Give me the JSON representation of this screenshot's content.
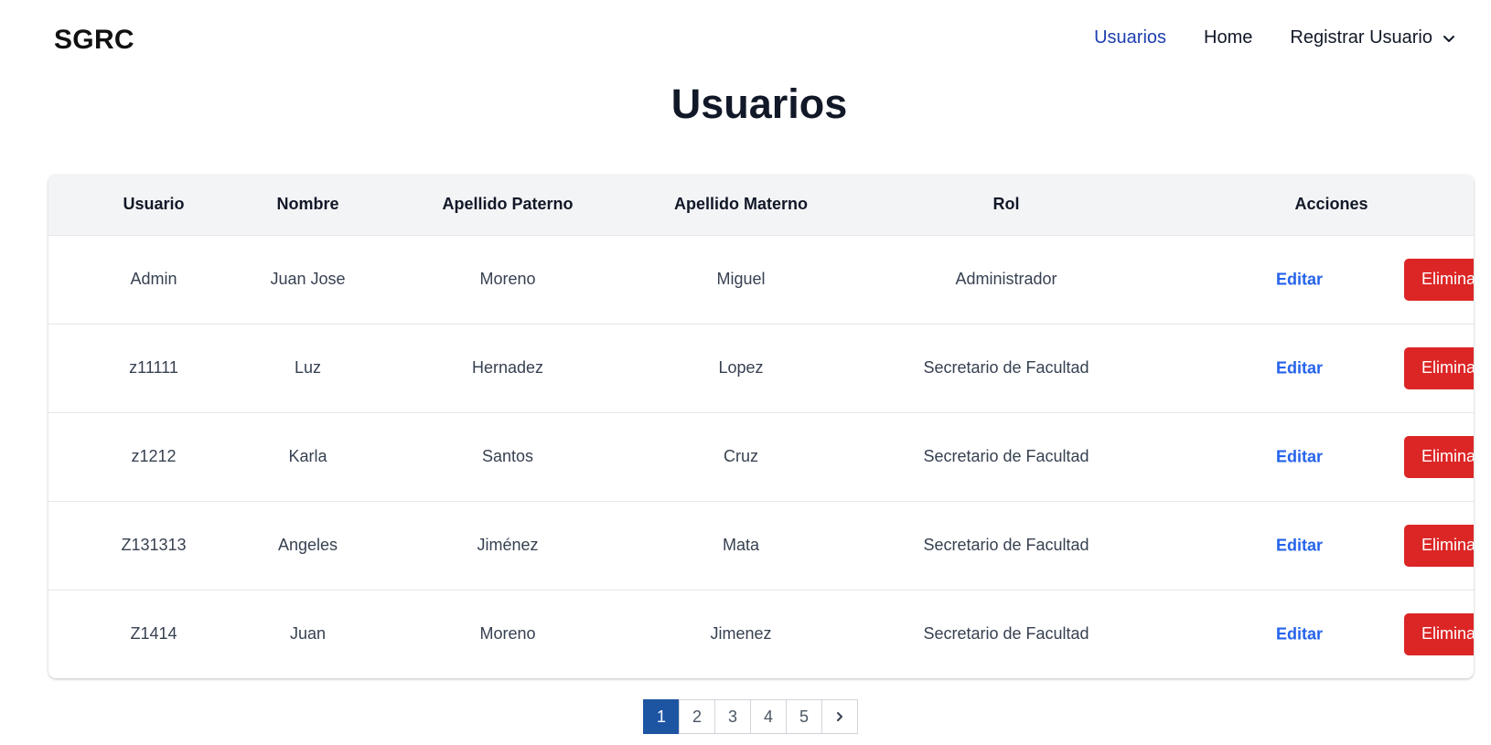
{
  "navbar": {
    "brand": "SGRC",
    "links": [
      {
        "label": "Usuarios",
        "active": true
      },
      {
        "label": "Home",
        "active": false
      }
    ],
    "dropdown": {
      "label": "Registrar Usuario",
      "icon": "chevron-down-icon"
    }
  },
  "page": {
    "title": "Usuarios"
  },
  "table": {
    "headers": [
      "Usuario",
      "Nombre",
      "Apellido Paterno",
      "Apellido Materno",
      "Rol",
      "Acciones"
    ],
    "rows": [
      {
        "usuario": "Admin",
        "nombre": "Juan Jose",
        "paterno": "Moreno",
        "materno": "Miguel",
        "rol": "Administrador"
      },
      {
        "usuario": "z11111",
        "nombre": "Luz",
        "paterno": "Hernadez",
        "materno": "Lopez",
        "rol": "Secretario de Facultad"
      },
      {
        "usuario": "z1212",
        "nombre": "Karla",
        "paterno": "Santos",
        "materno": "Cruz",
        "rol": "Secretario de Facultad"
      },
      {
        "usuario": "Z131313",
        "nombre": "Angeles",
        "paterno": "Jiménez",
        "materno": "Mata",
        "rol": "Secretario de Facultad"
      },
      {
        "usuario": "Z1414",
        "nombre": "Juan",
        "paterno": "Moreno",
        "materno": "Jimenez",
        "rol": "Secretario de Facultad"
      }
    ],
    "edit_label": "Editar",
    "delete_label": "Eliminar"
  },
  "pagination": {
    "pages": [
      "1",
      "2",
      "3",
      "4",
      "5"
    ],
    "current": "1",
    "next_icon": "chevron-right-icon"
  },
  "colors": {
    "accent": "#1e40af",
    "link": "#2563eb",
    "danger": "#dc2626",
    "pagination_active": "#1e55a3",
    "header_bg": "#f3f4f6"
  }
}
